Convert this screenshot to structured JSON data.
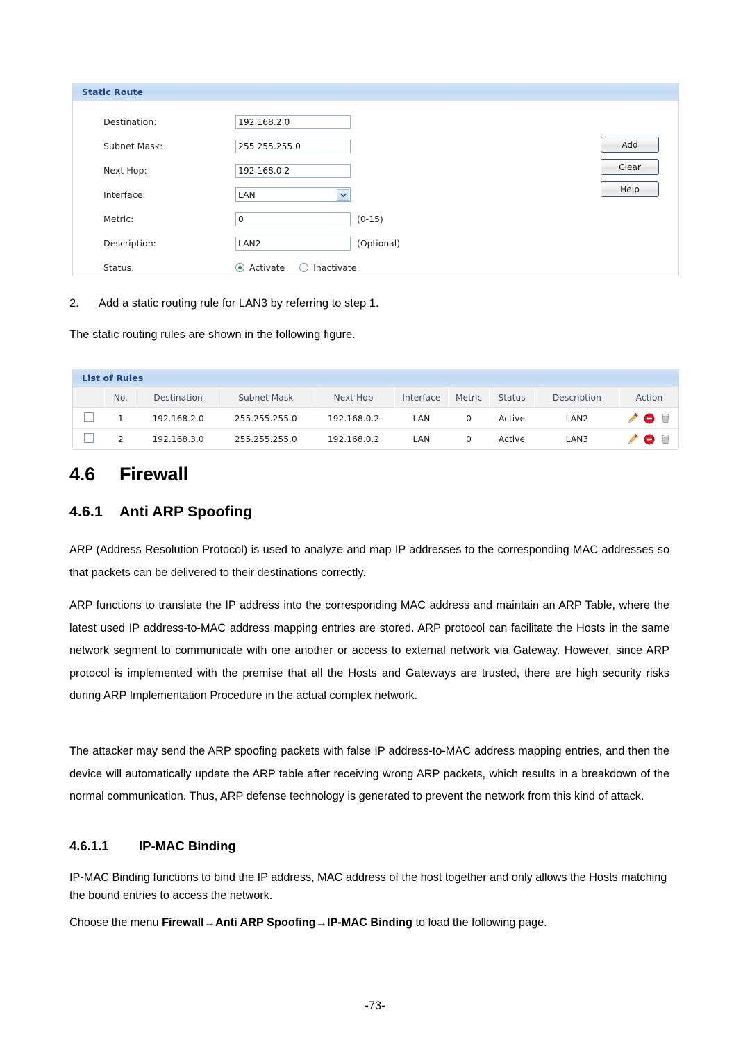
{
  "static_route_panel": {
    "title": "Static Route",
    "fields": [
      {
        "label": "Destination:",
        "value": "192.168.2.0",
        "hint": ""
      },
      {
        "label": "Subnet Mask:",
        "value": "255.255.255.0",
        "hint": ""
      },
      {
        "label": "Next Hop:",
        "value": "192.168.0.2",
        "hint": ""
      },
      {
        "label": "Interface:",
        "value": "LAN",
        "hint": ""
      },
      {
        "label": "Metric:",
        "value": "0",
        "hint": "(0-15)"
      },
      {
        "label": "Description:",
        "value": "LAN2",
        "hint": "(Optional)"
      }
    ],
    "status": {
      "label": "Status:",
      "activate_label": "Activate",
      "inactivate_label": "Inactivate",
      "selected": "Activate"
    },
    "buttons": [
      {
        "label": "Add"
      },
      {
        "label": "Clear"
      },
      {
        "label": "Help"
      }
    ]
  },
  "list_of_rules_panel": {
    "title": "List of Rules",
    "columns": [
      "",
      "No.",
      "Destination",
      "Subnet Mask",
      "Next Hop",
      "Interface",
      "Metric",
      "Status",
      "Description",
      "Action"
    ],
    "rows": [
      {
        "no": "1",
        "destination": "192.168.2.0",
        "subnet_mask": "255.255.255.0",
        "next_hop": "192.168.0.2",
        "interface": "LAN",
        "metric": "0",
        "status": "Active",
        "description": "LAN2"
      },
      {
        "no": "2",
        "destination": "192.168.3.0",
        "subnet_mask": "255.255.255.0",
        "next_hop": "192.168.0.2",
        "interface": "LAN",
        "metric": "0",
        "status": "Active",
        "description": "LAN3"
      }
    ]
  },
  "document": {
    "step": {
      "number": "2.",
      "text": "Add a static routing rule for LAN3 by referring to step 1."
    },
    "intro": "The static routing rules are shown in the following figure.",
    "section_heading": {
      "number": "4.6",
      "title": "Firewall"
    },
    "subsection_heading": {
      "number": "4.6.1",
      "title": "Anti ARP Spoofing"
    },
    "subsubsection_heading": {
      "number": "4.6.1.1",
      "title": "IP-MAC Binding"
    },
    "paragraphs": {
      "p1": "ARP (Address Resolution Protocol) is used to analyze and map IP addresses to the corresponding MAC addresses so that packets can be delivered to their destinations correctly.",
      "p2": "ARP functions to translate the IP address into the corresponding MAC address and maintain an ARP Table, where the latest used IP address-to-MAC address mapping entries are stored. ARP protocol can facilitate the Hosts in the same network segment to communicate with one another or access to external network via Gateway. However, since ARP protocol is implemented with the premise that all the Hosts and Gateways are trusted, there are high security risks during ARP Implementation Procedure in the actual complex network.",
      "p3": "The attacker may send the ARP spoofing packets with false IP address-to-MAC address mapping entries, and then the device will automatically update the ARP table after receiving wrong ARP packets, which results in a breakdown of the normal communication. Thus, ARP defense technology is generated to prevent the network from this kind of attack.",
      "p4": "IP-MAC Binding functions to bind the IP address, MAC address of the host together and only allows the Hosts matching the bound entries to access the network."
    },
    "menu_instruction": {
      "prefix": "Choose the menu ",
      "path": "Firewall→Anti ARP Spoofing→IP-MAC Binding",
      "suffix": " to load the following page."
    },
    "page_number": "-73-"
  },
  "icons": {
    "edit": "pencil-icon",
    "disable": "disable-icon",
    "delete": "trash-icon",
    "dropdown": "chevron-down-icon"
  },
  "colors": {
    "panel_header_bg": "#c5dcf5",
    "panel_header_text": "#1f3f86",
    "table_header_bg": "#f1f1f1",
    "table_header_text": "#3b4a63",
    "button_border": "#2e4d86",
    "radio_selected": "#2e9b3f",
    "icon_edit": "#f0a830",
    "icon_disable": "#d8192a",
    "icon_delete": "#b8b8b8"
  }
}
